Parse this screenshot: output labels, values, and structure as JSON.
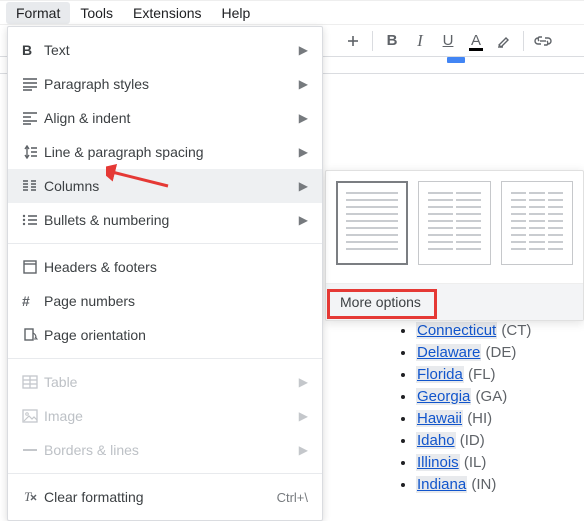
{
  "menubar": {
    "items": [
      "Format",
      "Tools",
      "Extensions",
      "Help"
    ],
    "active": 0
  },
  "toolbar": {
    "insert_image": "+",
    "bold": "B",
    "italic": "I",
    "underline": "U",
    "text_color": "A",
    "highlight": "✎",
    "insert_link": "⊂⊃"
  },
  "format_menu": {
    "text": "Text",
    "paragraph_styles": "Paragraph styles",
    "align_indent": "Align & indent",
    "line_spacing": "Line & paragraph spacing",
    "columns": "Columns",
    "bullets_numbering": "Bullets & numbering",
    "headers_footers": "Headers & footers",
    "page_numbers": "Page numbers",
    "page_orientation": "Page orientation",
    "table": "Table",
    "image": "Image",
    "borders_lines": "Borders & lines",
    "clear_formatting": "Clear formatting",
    "clear_shortcut": "Ctrl+\\"
  },
  "columns_submenu": {
    "more_options": "More options"
  },
  "doc": {
    "items": [
      {
        "name": "Connecticut",
        "abbr": "(CT)"
      },
      {
        "name": "Delaware",
        "abbr": "(DE)"
      },
      {
        "name": "Florida",
        "abbr": "(FL)"
      },
      {
        "name": "Georgia",
        "abbr": "(GA)"
      },
      {
        "name": "Hawaii",
        "abbr": "(HI)"
      },
      {
        "name": "Idaho",
        "abbr": "(ID)"
      },
      {
        "name": "Illinois",
        "abbr": "(IL)"
      },
      {
        "name": "Indiana",
        "abbr": "(IN)"
      }
    ]
  }
}
